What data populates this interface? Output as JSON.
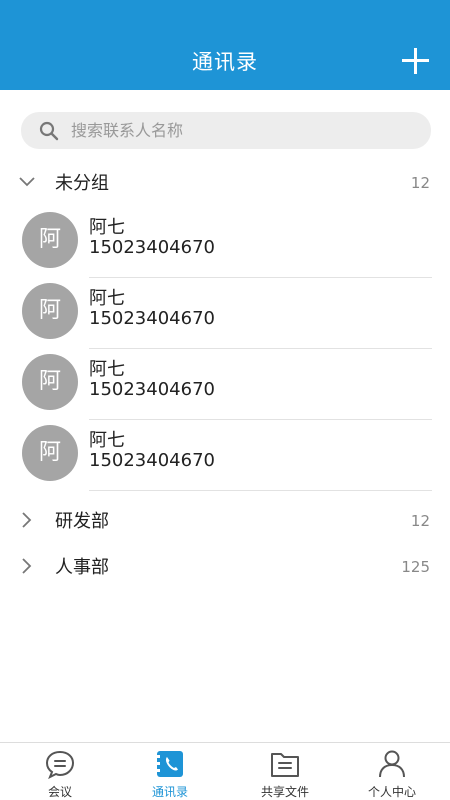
{
  "header": {
    "title": "通讯录"
  },
  "search": {
    "placeholder": "搜索联系人名称"
  },
  "groups": [
    {
      "name": "未分组",
      "count": "12",
      "expanded": true,
      "contacts": [
        {
          "avatar": "阿",
          "name": "阿七",
          "phone": "15023404670"
        },
        {
          "avatar": "阿",
          "name": "阿七",
          "phone": "15023404670"
        },
        {
          "avatar": "阿",
          "name": "阿七",
          "phone": "15023404670"
        },
        {
          "avatar": "阿",
          "name": "阿七",
          "phone": "15023404670"
        }
      ]
    },
    {
      "name": "研发部",
      "count": "12",
      "expanded": false
    },
    {
      "name": "人事部",
      "count": "125",
      "expanded": false
    }
  ],
  "tabs": [
    {
      "label": "会议",
      "icon": "chat-bubble-icon",
      "active": false
    },
    {
      "label": "通讯录",
      "icon": "phone-book-icon",
      "active": true
    },
    {
      "label": "共享文件",
      "icon": "folder-icon",
      "active": false
    },
    {
      "label": "个人中心",
      "icon": "user-icon",
      "active": false
    }
  ],
  "colors": {
    "accent": "#1E94D6",
    "avatar": "#A5A5A5",
    "search_bg": "#EDEDED"
  }
}
